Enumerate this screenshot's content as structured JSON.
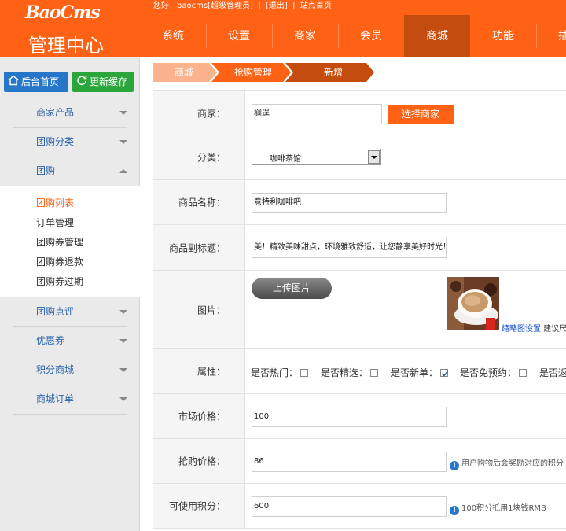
{
  "brand": {
    "logo": "BaoCms",
    "admin_title": "管理中心"
  },
  "userbar": {
    "greeting": "您好！baocms[超级管理员]",
    "logout": "[退出]",
    "sep": "|",
    "site_home": "站点首页"
  },
  "nav": [
    "系统",
    "设置",
    "商家",
    "会员",
    "商城",
    "功能",
    "插"
  ],
  "nav_active": "商城",
  "sidebar": {
    "home_btn": "后台首页",
    "cache_btn": "更新缓存",
    "menus_top": [
      "商家产品",
      "团购分类",
      "团购"
    ],
    "submenu": [
      "团购列表",
      "订单管理",
      "团购券管理",
      "团购券退款",
      "团购券过期"
    ],
    "submenu_active": "团购列表",
    "menus_bottom": [
      "团购点评",
      "优惠券",
      "积分商城",
      "商城订单"
    ]
  },
  "breadcrumb": [
    "商城",
    "抢购管理",
    "新增"
  ],
  "form": {
    "merchant_label": "商家：",
    "merchant_value": "榈逞",
    "select_merchant_btn": "选择商家",
    "category_label": "分类：",
    "category_value": "咖啡茶馆",
    "product_name_label": "商品名称：",
    "product_name_value": "意特利咖啡吧",
    "subtitle_label": "商品副标题：",
    "subtitle_value": "美！精致美味甜点，环境雅致舒适，让您静享美好时光！",
    "image_label": "图片：",
    "upload_btn": "上传图片",
    "thumb_link": "缩略图设置",
    "thumb_hint": "建议尺",
    "attr_label": "属性：",
    "attrs": [
      {
        "label": "是否热门：",
        "checked": false
      },
      {
        "label": "是否精选：",
        "checked": false
      },
      {
        "label": "是否新单：",
        "checked": true
      },
      {
        "label": "是否免预约：",
        "checked": false
      },
      {
        "label": "是否返",
        "checked": false
      }
    ],
    "market_price_label": "市场价格：",
    "market_price_value": "100",
    "flash_price_label": "抢购价格：",
    "flash_price_value": "86",
    "flash_price_hint": "用户购物后会奖励对应的积分",
    "points_label": "可使用积分：",
    "points_value": "600",
    "points_hint": "100积分抵用1块钱RMB"
  },
  "colors": {
    "brand_orange": "#ff6215",
    "nav_active": "#c44c0e",
    "link_blue": "#2a63a8",
    "home_btn": "#2677c9",
    "cache_btn": "#2aa63a"
  }
}
